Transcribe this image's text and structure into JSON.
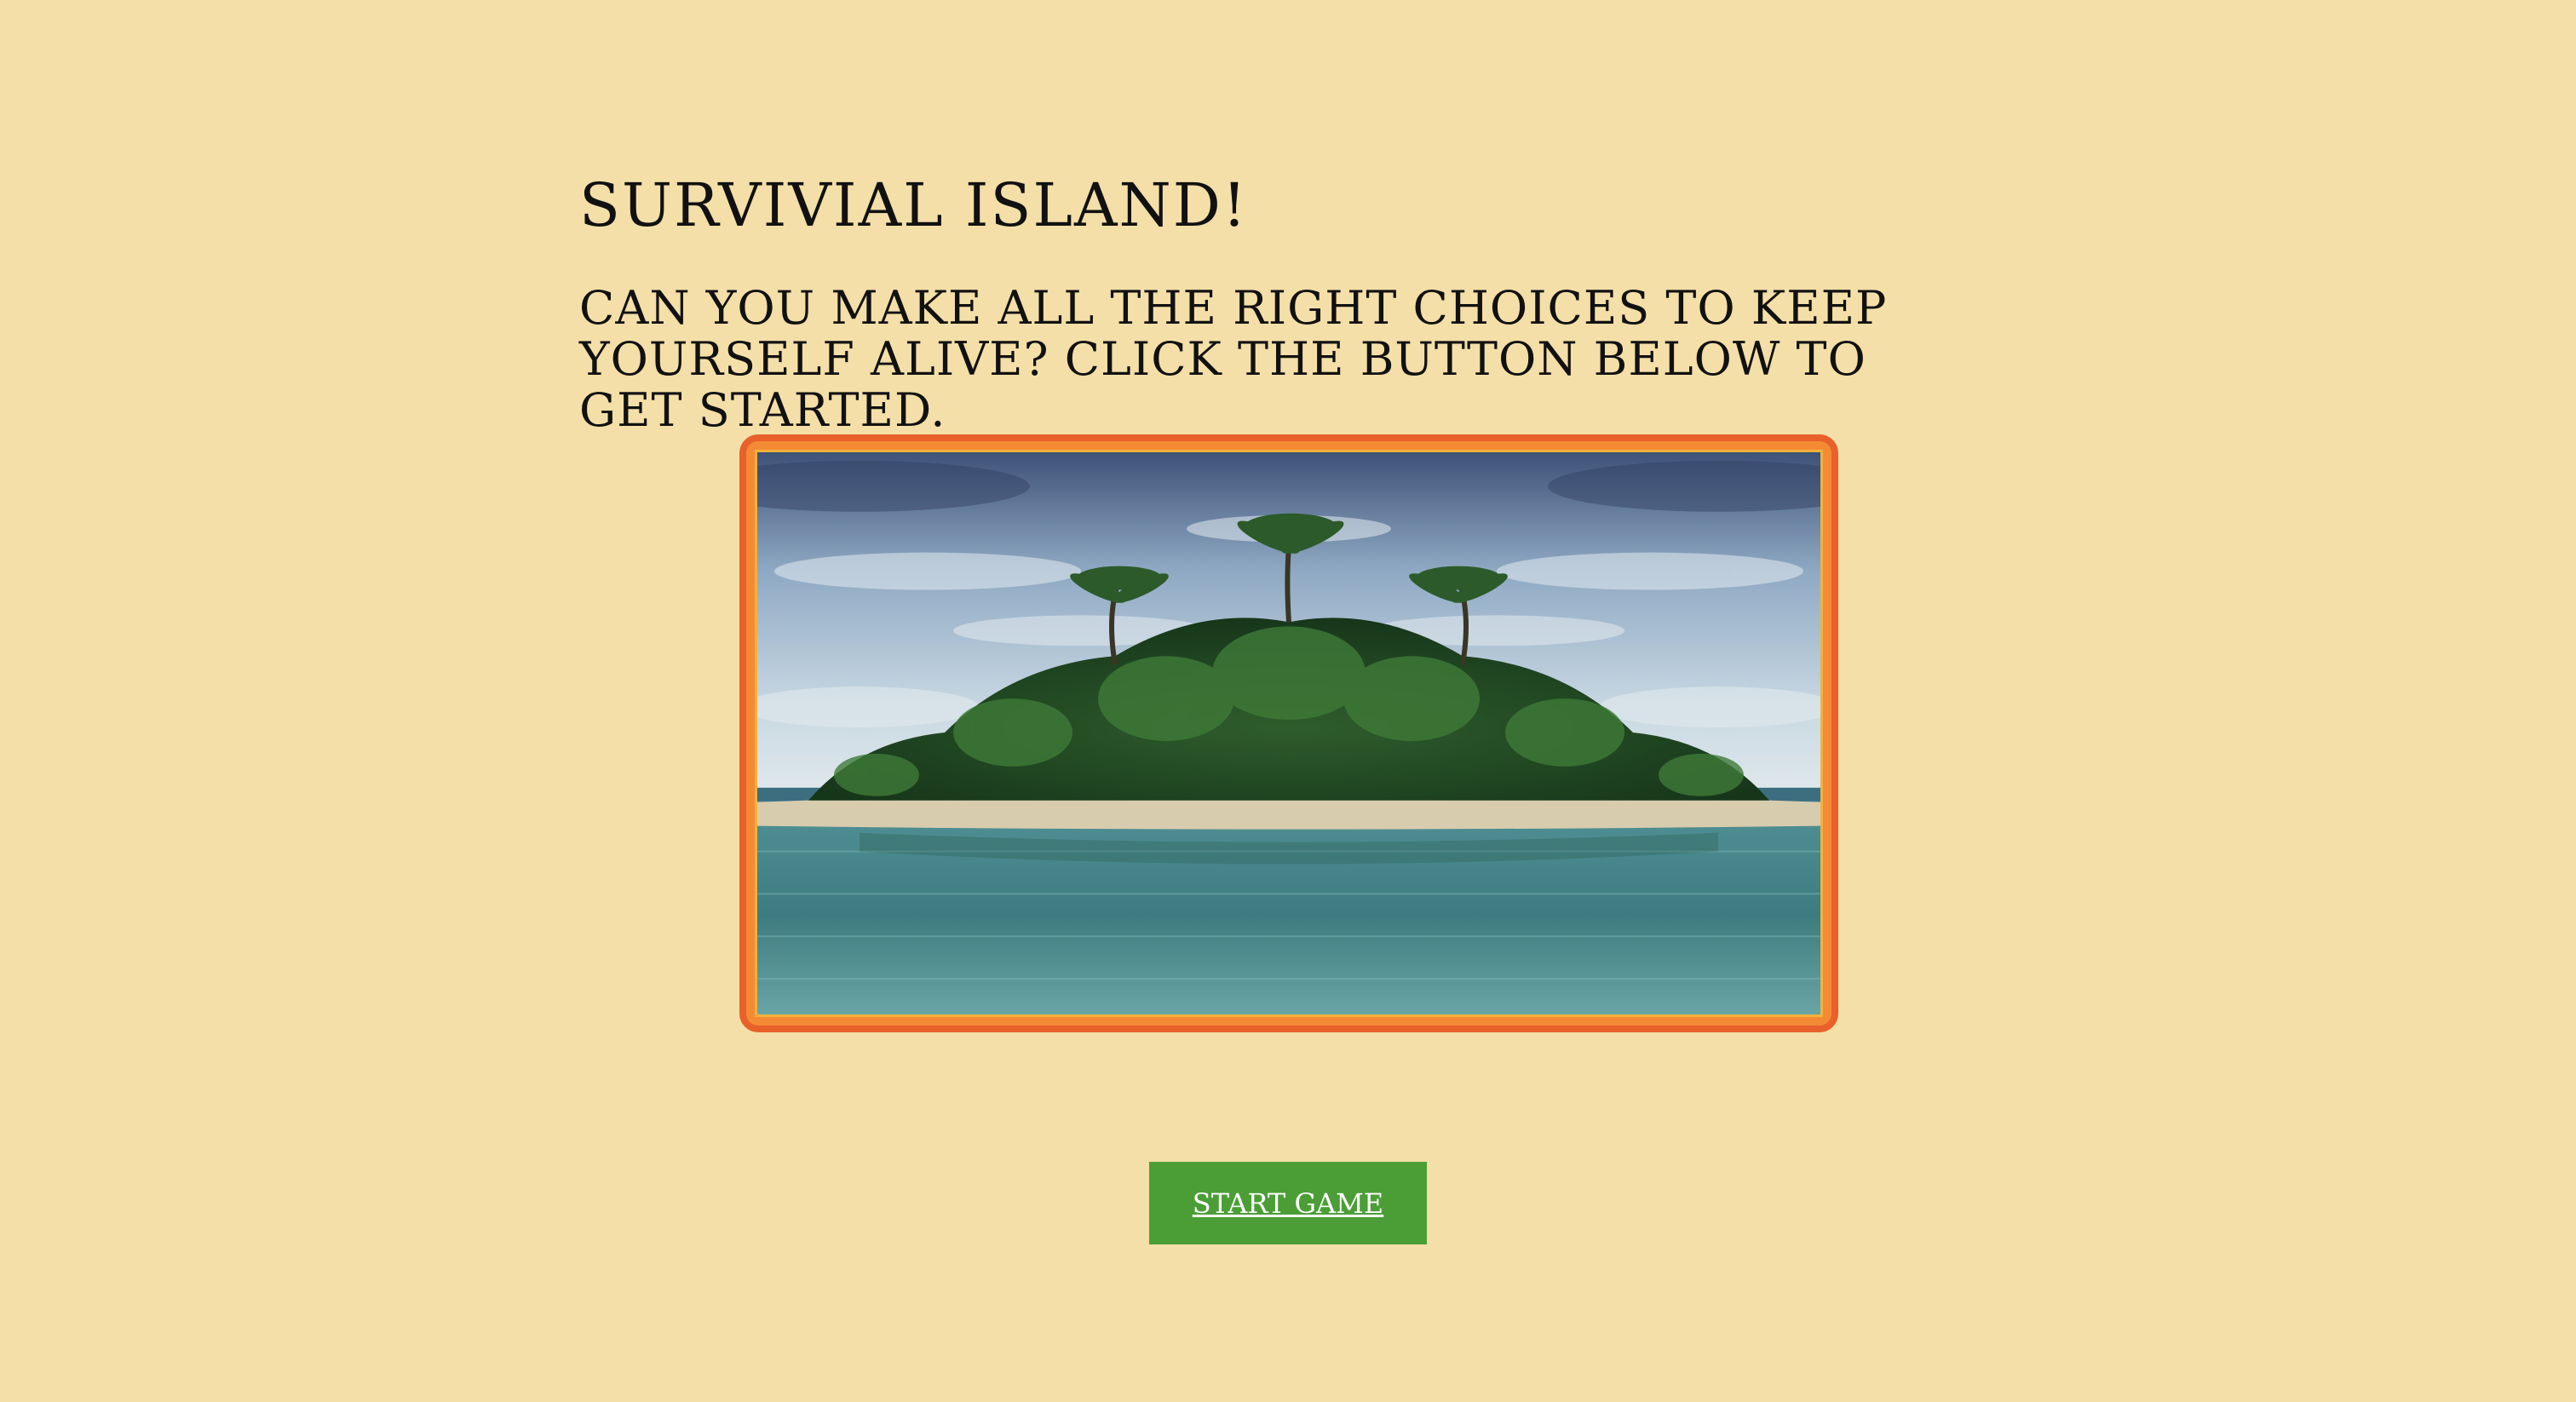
{
  "page": {
    "title": "SURVIVIAL ISLAND!",
    "subtitle": "CAN YOU MAKE ALL THE RIGHT CHOICES TO KEEP YOURSELF ALIVE? CLICK THE BUTTON BELOW TO GET STARTED."
  },
  "hero_image": {
    "icon": "tropical-island-image"
  },
  "start_button": {
    "label": "START GAME"
  },
  "colors": {
    "background": "#f4dfa8",
    "frame_border": "#e8602a",
    "frame_fill": "#f58a35",
    "button": "#4b9e36",
    "button_text": "#ffffff"
  }
}
